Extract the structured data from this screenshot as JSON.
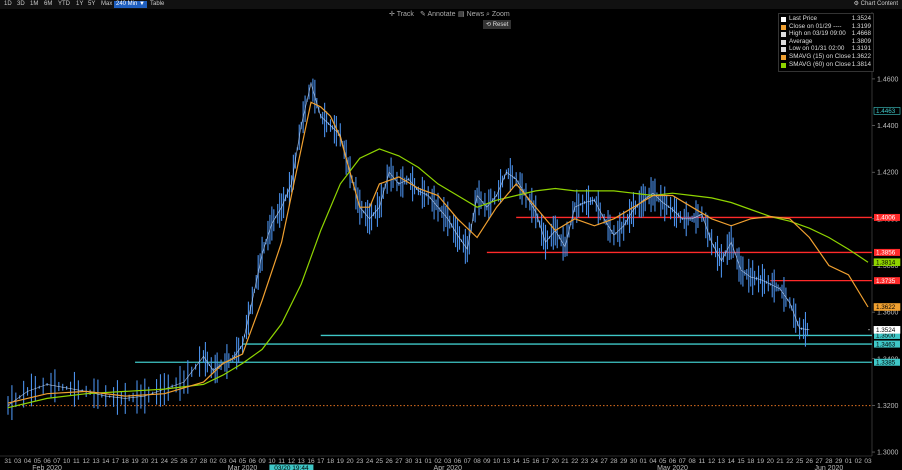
{
  "toolbar": {
    "timeframes": [
      "1D",
      "3D",
      "1M",
      "6M",
      "YTD",
      "1Y",
      "5Y",
      "Max",
      "240 Min ▼",
      "Table"
    ],
    "selected": "240 Min ▼",
    "chart_content": "Chart Content",
    "tools": [
      "Track",
      "Annotate",
      "News",
      "Zoom"
    ],
    "reset": "Reset"
  },
  "legend": [
    {
      "label": "Last Price",
      "value": "1.3524",
      "color": "#ffffff"
    },
    {
      "label": "Close on 01/29 ----",
      "value": "1.3199",
      "color": "#f0a030"
    },
    {
      "label": "High on 03/19 09:00",
      "value": "1.4668",
      "color": "#dddddd"
    },
    {
      "label": "Average",
      "value": "1.3809",
      "color": "#dddddd"
    },
    {
      "label": "Low on 01/31 02:00",
      "value": "1.3191",
      "color": "#dddddd"
    },
    {
      "label": "SMAVG (15) on Close",
      "value": "1.3622",
      "color": "#f0a030"
    },
    {
      "label": "SMAVG (60) on Close",
      "value": "1.3814",
      "color": "#8fd400"
    }
  ],
  "colors": {
    "price": "#4a8fe8",
    "sma15": "#f0a030",
    "sma60": "#8fd400",
    "resistance": "#ff2a2a",
    "support": "#3fc7c7",
    "ref": "#e07020"
  },
  "chart_data": {
    "type": "line",
    "ylim": [
      1.2983,
      1.4887
    ],
    "yticks": [
      "1.3000",
      "1.3200",
      "1.3400",
      "1.3600",
      "1.3800",
      "1.4000",
      "1.4200",
      "1.4400",
      "1.4600"
    ],
    "x_day_labels": [
      "31",
      "03",
      "04",
      "05",
      "06",
      "07",
      "10",
      "11",
      "12",
      "13",
      "14",
      "17",
      "18",
      "19",
      "20",
      "21",
      "24",
      "25",
      "26",
      "27",
      "28",
      "02",
      "03",
      "04",
      "05",
      "06",
      "09",
      "10",
      "11",
      "12",
      "13",
      "16",
      "17",
      "18",
      "19",
      "20",
      "23",
      "24",
      "25",
      "26",
      "27",
      "30",
      "31",
      "01",
      "02",
      "03",
      "06",
      "07",
      "08",
      "09",
      "10",
      "13",
      "14",
      "15",
      "16",
      "17",
      "20",
      "21",
      "22",
      "23",
      "24",
      "27",
      "28",
      "29",
      "30",
      "01",
      "04",
      "05",
      "06",
      "07",
      "08",
      "11",
      "12",
      "13",
      "14",
      "15",
      "18",
      "19",
      "20",
      "21",
      "22",
      "25",
      "26",
      "27",
      "28",
      "29",
      "01",
      "02",
      "03"
    ],
    "months": [
      {
        "label": "Feb 2020",
        "index": 4
      },
      {
        "label": "Mar 2020",
        "index": 24
      },
      {
        "label": "Apr 2020",
        "index": 45
      },
      {
        "label": "May 2020",
        "index": 68
      },
      {
        "label": "Jun 2020",
        "index": 84
      }
    ],
    "crosshair_label": "03/20 19:44",
    "price_series": {
      "name": "Last Price",
      "x": [
        0,
        2,
        4,
        6,
        8,
        10,
        12,
        14,
        16,
        18,
        20,
        21,
        22,
        23,
        24,
        25,
        26,
        27,
        28,
        29,
        30,
        31,
        32,
        33,
        34,
        35,
        36,
        37,
        38,
        39,
        40,
        41,
        42,
        43,
        44,
        45,
        46,
        47,
        48,
        49,
        50,
        51,
        52,
        53,
        54,
        55,
        56,
        57,
        58,
        59,
        60,
        61,
        62,
        63,
        64,
        65,
        66,
        67,
        68,
        69,
        70,
        71,
        72,
        73,
        74,
        75,
        76,
        77,
        78,
        79,
        80,
        81,
        82,
        83,
        84,
        85,
        86,
        87,
        88
      ],
      "y": [
        1.32,
        1.326,
        1.329,
        1.3275,
        1.326,
        1.324,
        1.323,
        1.324,
        1.327,
        1.33,
        1.341,
        1.335,
        1.338,
        1.34,
        1.346,
        1.365,
        1.385,
        1.398,
        1.405,
        1.415,
        1.44,
        1.458,
        1.444,
        1.44,
        1.436,
        1.42,
        1.405,
        1.4,
        1.405,
        1.42,
        1.415,
        1.417,
        1.412,
        1.41,
        1.405,
        1.4,
        1.393,
        1.387,
        1.41,
        1.405,
        1.41,
        1.42,
        1.417,
        1.41,
        1.403,
        1.39,
        1.395,
        1.388,
        1.405,
        1.407,
        1.408,
        1.4,
        1.393,
        1.397,
        1.404,
        1.408,
        1.411,
        1.407,
        1.404,
        1.4,
        1.4,
        1.402,
        1.39,
        1.382,
        1.39,
        1.378,
        1.375,
        1.374,
        1.372,
        1.37,
        1.364,
        1.353,
        1.3524
      ],
      "note": "values estimated from chart"
    },
    "sma15": {
      "name": "SMAVG (15) on Close",
      "x": [
        0,
        4,
        8,
        12,
        16,
        20,
        22,
        24,
        26,
        28,
        29,
        30,
        31,
        32,
        33,
        34,
        35,
        36,
        37,
        38,
        40,
        42,
        44,
        46,
        48,
        50,
        52,
        54,
        56,
        58,
        60,
        62,
        64,
        66,
        68,
        70,
        72,
        74,
        76,
        78,
        80,
        82,
        84,
        86,
        88
      ],
      "y": [
        1.321,
        1.325,
        1.326,
        1.324,
        1.325,
        1.33,
        1.338,
        1.342,
        1.365,
        1.39,
        1.41,
        1.43,
        1.45,
        1.448,
        1.444,
        1.435,
        1.42,
        1.405,
        1.405,
        1.415,
        1.418,
        1.413,
        1.41,
        1.4,
        1.392,
        1.405,
        1.415,
        1.405,
        1.395,
        1.4,
        1.397,
        1.4,
        1.405,
        1.41,
        1.41,
        1.405,
        1.4,
        1.397,
        1.4,
        1.401,
        1.4,
        1.392,
        1.38,
        1.376,
        1.3622
      ]
    },
    "sma60": {
      "name": "SMAVG (60) on Close",
      "x": [
        0,
        4,
        8,
        12,
        16,
        20,
        22,
        24,
        26,
        28,
        30,
        32,
        34,
        36,
        38,
        40,
        42,
        44,
        46,
        48,
        50,
        52,
        54,
        56,
        58,
        60,
        62,
        64,
        66,
        68,
        70,
        72,
        74,
        76,
        78,
        80,
        82,
        84,
        86,
        88
      ],
      "y": [
        1.319,
        1.323,
        1.325,
        1.326,
        1.327,
        1.329,
        1.333,
        1.338,
        1.344,
        1.355,
        1.372,
        1.395,
        1.415,
        1.426,
        1.43,
        1.427,
        1.422,
        1.415,
        1.41,
        1.405,
        1.408,
        1.41,
        1.412,
        1.413,
        1.412,
        1.412,
        1.412,
        1.411,
        1.41,
        1.411,
        1.41,
        1.409,
        1.407,
        1.404,
        1.401,
        1.399,
        1.396,
        1.392,
        1.387,
        1.3814
      ]
    },
    "hlines": [
      {
        "value": 1.4006,
        "x_from": 52,
        "color": "#ff2a2a",
        "label": "1.4006"
      },
      {
        "value": 1.3856,
        "x_from": 49,
        "color": "#ff2a2a",
        "label": "1.3856"
      },
      {
        "value": 1.3735,
        "x_from": 78,
        "color": "#ff2a2a",
        "label": "1.3735"
      },
      {
        "value": 1.35,
        "x_from": 32,
        "color": "#3fc7c7",
        "label": "1.3500"
      },
      {
        "value": 1.3463,
        "x_from": 24,
        "color": "#3fc7c7",
        "label": "1.3463"
      },
      {
        "value": 1.3385,
        "x_from": 13,
        "color": "#3fc7c7",
        "label": "1.3385"
      },
      {
        "value": 1.3199,
        "x_from": 0,
        "color": "#e07020",
        "label": "",
        "dotted": true
      }
    ],
    "right_tags": [
      {
        "label": "1.4463",
        "value": 1.4463,
        "bg": "#000",
        "fg": "#3fc7c7",
        "border": "#3fc7c7"
      },
      {
        "label": "1.3814",
        "value": 1.3814,
        "bg": "#8fd400",
        "fg": "#000",
        "border": "#8fd400"
      },
      {
        "label": "1.3622",
        "value": 1.3622,
        "bg": "#f0a030",
        "fg": "#000",
        "border": "#f0a030"
      },
      {
        "label": "1.3524",
        "value": 1.3524,
        "bg": "#ffffff",
        "fg": "#000",
        "border": "#ffffff"
      }
    ]
  }
}
